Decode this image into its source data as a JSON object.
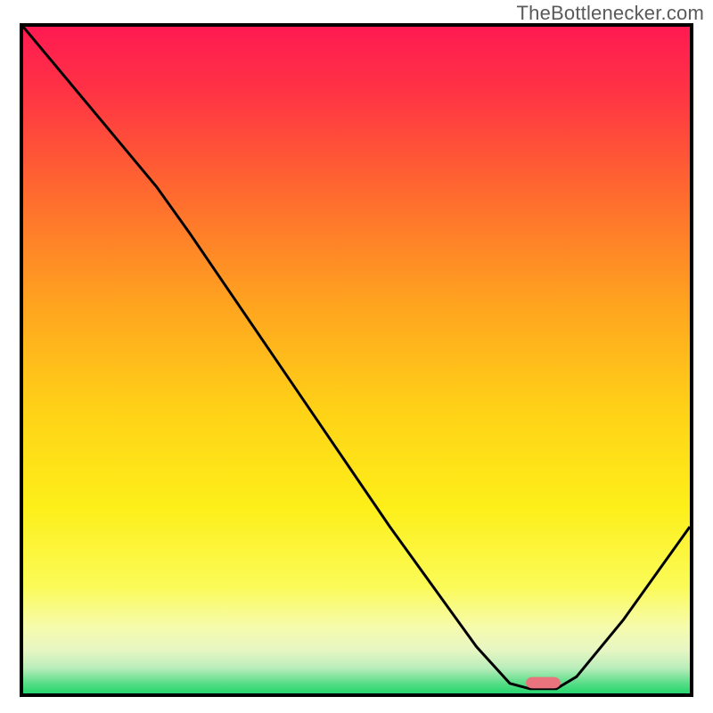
{
  "watermark": "TheBottlenecker.com",
  "chart_data": {
    "type": "line",
    "title": "",
    "xlabel": "",
    "ylabel": "",
    "x_range": [
      0,
      100
    ],
    "y_range_visual": [
      0,
      100
    ],
    "gradient_stops": [
      {
        "offset": 0.0,
        "color": "#ff1a52"
      },
      {
        "offset": 0.1,
        "color": "#ff3444"
      },
      {
        "offset": 0.25,
        "color": "#ff6a2f"
      },
      {
        "offset": 0.42,
        "color": "#ffa51f"
      },
      {
        "offset": 0.58,
        "color": "#ffd317"
      },
      {
        "offset": 0.72,
        "color": "#fdef19"
      },
      {
        "offset": 0.84,
        "color": "#fbfb58"
      },
      {
        "offset": 0.9,
        "color": "#f6fbac"
      },
      {
        "offset": 0.935,
        "color": "#e7f6c3"
      },
      {
        "offset": 0.962,
        "color": "#b9edbb"
      },
      {
        "offset": 0.985,
        "color": "#58dd87"
      },
      {
        "offset": 1.0,
        "color": "#27d66e"
      }
    ],
    "curve_points": [
      {
        "x": 0,
        "y": 100
      },
      {
        "x": 20,
        "y": 76
      },
      {
        "x": 25,
        "y": 69
      },
      {
        "x": 40,
        "y": 47
      },
      {
        "x": 55,
        "y": 25
      },
      {
        "x": 68,
        "y": 7
      },
      {
        "x": 73,
        "y": 1.5
      },
      {
        "x": 76,
        "y": 0.7
      },
      {
        "x": 80,
        "y": 0.7
      },
      {
        "x": 83,
        "y": 2.5
      },
      {
        "x": 90,
        "y": 11
      },
      {
        "x": 100,
        "y": 25
      }
    ],
    "marker": {
      "x_center": 78,
      "y_center": 1.6,
      "width": 5.2,
      "height": 1.7,
      "color": "#e9747e",
      "rx": 1.0
    },
    "note": "y values are visual positions (0 bottom, 100 top) read off the rendered curve; the source image has no numeric axis labels."
  }
}
